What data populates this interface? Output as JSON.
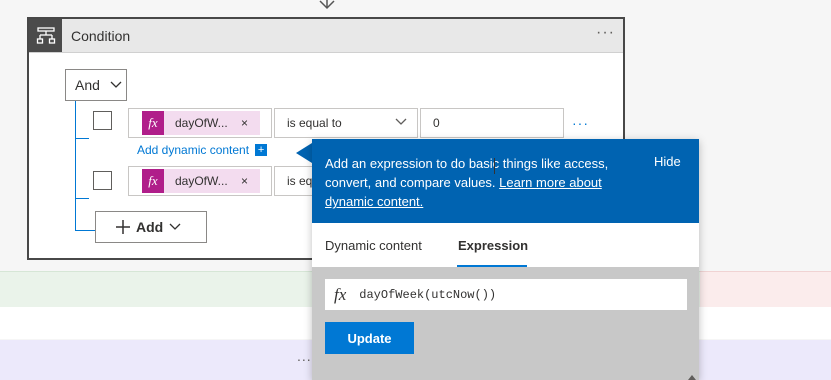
{
  "background": {
    "more_dots": "..."
  },
  "condition_card": {
    "title": "Condition",
    "more": "···",
    "group_operator": "And",
    "rows": [
      {
        "token": "dayOfW...",
        "token_remove": "×",
        "operator": "is equal to",
        "value": "0",
        "more": "···"
      },
      {
        "token": "dayOfW...",
        "token_remove": "×",
        "operator": "is equal to"
      }
    ],
    "add_dynamic_content": "Add dynamic content",
    "add_dynamic_plus": "+",
    "add_button": "Add"
  },
  "popover": {
    "description_prefix": "Add an expression to do basic things like access, convert, and compare values. ",
    "learn_more_link": "Learn more about dynamic content.",
    "hide": "Hide",
    "tabs": [
      "Dynamic content",
      "Expression"
    ],
    "active_tab": "Expression",
    "fx_symbol": "fx",
    "expression": "dayOfWeek(utcNow())",
    "update_button": "Update"
  },
  "colors": {
    "accent": "#0078d4",
    "popover_header": "#0063b1",
    "token_badge": "#b01e8a",
    "token_background": "#f3dcef"
  }
}
